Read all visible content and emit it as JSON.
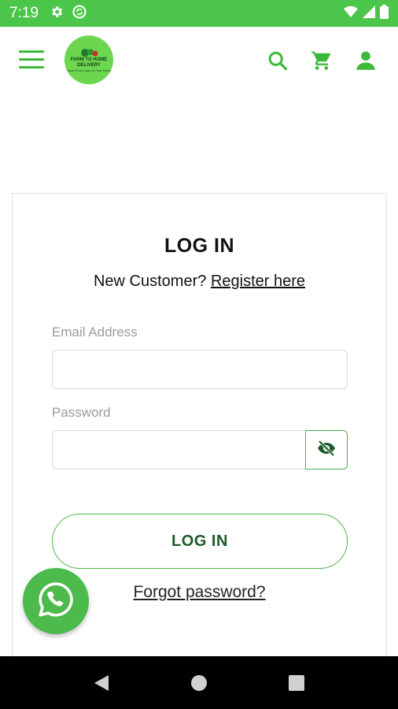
{
  "status_bar": {
    "time": "7:19",
    "left_icons": [
      "gear-icon",
      "sync-icon"
    ],
    "right_icons": [
      "wifi-icon",
      "signal-icon",
      "battery-icon"
    ]
  },
  "header": {
    "menu_icon": "hamburger-menu-icon",
    "logo_text": "FARM TO HOME DELIVERY",
    "logo_subtext": "Fresh From Farm To Your Home",
    "icons": [
      "search-icon",
      "cart-icon",
      "account-icon"
    ]
  },
  "login": {
    "title": "LOG IN",
    "new_customer_text": "New Customer?",
    "register_link": "Register here",
    "email_label": "Email Address",
    "email_value": "",
    "password_label": "Password",
    "password_value": "",
    "toggle_icon": "eye-off-icon",
    "submit_label": "LOG IN",
    "forgot_password": "Forgot password?"
  },
  "fab": {
    "icon": "whatsapp-icon"
  },
  "nav_bar": {
    "buttons": [
      "back",
      "home",
      "recents"
    ]
  },
  "colors": {
    "accent": "#4cc64a",
    "button_text": "#1e5b2a",
    "fab": "#4cbb4b"
  }
}
